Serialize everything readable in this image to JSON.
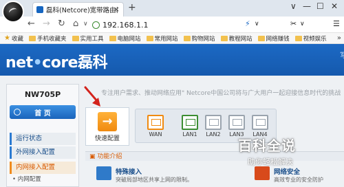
{
  "browser": {
    "tab_title": "磊科(Netcore)宽带路由器管理",
    "tab_close": "×",
    "new_tab": "+",
    "window_controls": [
      "∨",
      "—",
      "☐",
      "✕"
    ],
    "nav": {
      "back": "←",
      "forward": "→",
      "refresh": "↻",
      "home": "⌂",
      "dropdown": "∨"
    },
    "url": "192.168.1.1",
    "address_icons": [
      "⚡",
      "∨",
      "✂",
      "∨",
      "☰"
    ]
  },
  "bookmarks": {
    "label": "收藏",
    "items": [
      "手机收藏夹",
      "实用工具",
      "电脑网站",
      "常用网站",
      "购物网站",
      "教程网站",
      "网络赚钱",
      "视频娱乐"
    ],
    "more": "»"
  },
  "router": {
    "brand_left": "net",
    "brand_sep": "•",
    "brand_right": "core磊科",
    "header_link": "写",
    "model": "NW705P",
    "home_button": "首  页",
    "menu": [
      {
        "label": "运行状态",
        "active": false
      },
      {
        "label": "外网接入配置",
        "active": false
      },
      {
        "label": "内网接入配置",
        "active": true
      }
    ],
    "submenu": [
      "• 内网配置"
    ],
    "slogan": "专注用户需求、推动网络应用\" Netcore中国公司将与广大用户一起迎接信息时代的挑战",
    "quick_setup": {
      "icon": "→",
      "label": "快速配置"
    },
    "ports": [
      "WAN",
      "LAN1",
      "LAN2",
      "LAN3",
      "LAN4"
    ],
    "function_intro": "功能介绍",
    "features": [
      {
        "title": "特殊接入",
        "desc": "突破局部地区共享上网的限制。"
      },
      {
        "title": "网络安全",
        "desc": "高效专业的安全防护"
      }
    ]
  },
  "watermark": {
    "title": "百科全说",
    "subtitle": "助你轻松解决"
  },
  "colors": {
    "header_blue": "#1c69c4",
    "accent_orange": "#f08a10",
    "lan_green": "#3c8d32"
  }
}
